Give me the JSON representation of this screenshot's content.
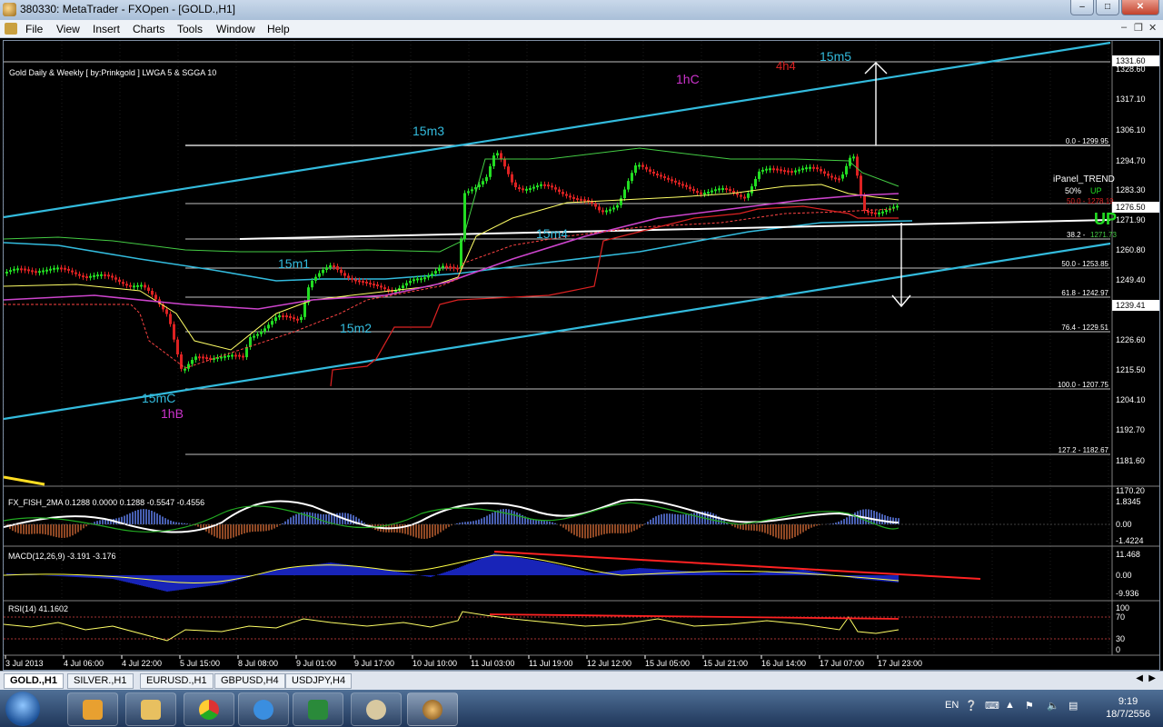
{
  "window": {
    "title": "380330: MetaTrader - FXOpen - [GOLD.,H1]"
  },
  "menu": [
    "File",
    "View",
    "Insert",
    "Charts",
    "Tools",
    "Window",
    "Help"
  ],
  "chart": {
    "info": "Gold Daily & Weekly [ by:Prinkgold ] LWGA 5  &  SGGA 10",
    "price_labels": [
      "1331.60",
      "1328.60",
      "1317.10",
      "1306.10",
      "1294.70",
      "1283.30",
      "1276.50",
      "1271.90",
      "1260.80",
      "1249.40",
      "1239.41",
      "1226.60",
      "1215.50",
      "1204.10",
      "1192.70",
      "1181.60",
      "1170.20"
    ],
    "fib_labels": [
      "0.0 - 1299.95",
      "50.0 - 1253.85",
      "61.8 - 1242.97",
      "76.4 - 1229.51",
      "100.0 - 1207.75",
      "127.2 - 1182.67"
    ],
    "annotations": [
      "15m5",
      "4h4",
      "1hC",
      "15m3",
      "15m4",
      "15m1",
      "15m2",
      "15mC",
      "1hB"
    ],
    "ipanel": {
      "title": "iPanel_TREND",
      "pct": "50%",
      "trend": "UP",
      "big": "UP",
      "small": "38.2 -",
      "mid": "50.0 - 1278.19",
      "tag": "1271.73"
    },
    "fisher": {
      "label": "FX_FISH_2MA 0.1288 0.0000 0.1288 -0.5547 -0.4556",
      "scale": [
        "1.8345",
        "0.00",
        "-1.4224"
      ]
    },
    "macd": {
      "label": "MACD(12,26,9) -3.191 -3.176",
      "scale": [
        "11.468",
        "0.00",
        "-9.936"
      ]
    },
    "rsi": {
      "label": "RSI(14) 41.1602",
      "scale": [
        "100",
        "70",
        "30",
        "0"
      ]
    },
    "time_labels": [
      "3 Jul 2013",
      "4 Jul 06:00",
      "4 Jul 22:00",
      "5 Jul 15:00",
      "8 Jul 08:00",
      "9 Jul 01:00",
      "9 Jul 17:00",
      "10 Jul 10:00",
      "11 Jul 03:00",
      "11 Jul 19:00",
      "12 Jul 12:00",
      "15 Jul 05:00",
      "15 Jul 21:00",
      "16 Jul 14:00",
      "17 Jul 07:00",
      "17 Jul 23:00"
    ]
  },
  "tabs": [
    "GOLD.,H1",
    "SILVER.,H1",
    "EURUSD.,H1",
    "GBPUSD,H4",
    "USDJPY,H4"
  ],
  "taskbar": {
    "lang": "EN",
    "time": "9:19",
    "date": "18/7/2556"
  },
  "colors": {
    "bull": "#22dd22",
    "bear": "#dd2222",
    "channel": "#33bbdd",
    "fib": "#ffffff"
  }
}
